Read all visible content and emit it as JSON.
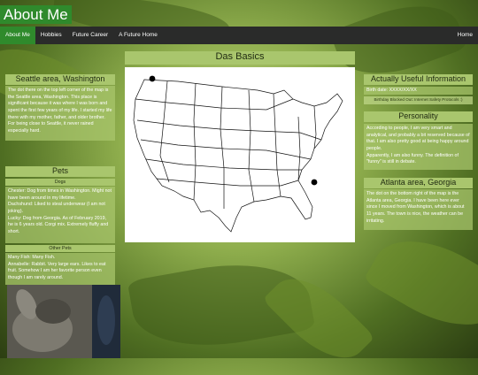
{
  "site": {
    "title": "About Me"
  },
  "nav": {
    "items": [
      "About Me",
      "Hobbies",
      "Future Career",
      "A Future Home"
    ],
    "home": "Home"
  },
  "center": {
    "title": "Das Basics"
  },
  "seattle": {
    "title": "Seattle area, Washington",
    "text": "The dot there on the top left corner of the map is the Seattle area, Washington. This place is significant because it was where I was born and spent the first few years of my life. I started my life there with my mother, father, and older brother. For being close to Seattle, it never rained especially hard."
  },
  "pets": {
    "title": "Pets",
    "dogs_title": "Dogs",
    "dogs_text": "Chester: Dog from times in Washington. Might not have been around in my lifetime.\nDachshund: Liked to steal underwear (I am not joking).\nLucky: Dog from Georgia. As of February 2019, he is 6 years old. Corgi mix. Extremely fluffy and short.",
    "other_title": "Other Pets",
    "other_text": "Many Fish: Many Fish.\nAnnabelle: Rabbit. Very large ears. Likes to eat fruit. Somehow I am her favorite person even though I am rarely around."
  },
  "useful": {
    "title": "Actually Useful Information",
    "birth": "Birth date: XXXX/XX/XX",
    "blocked": "Birthday Blocked Out: Internet Safety Protocols :)"
  },
  "personality": {
    "title": "Personality",
    "text": "According to people, I am very smart and analytical, and probably a bit reserved because of that. I am also pretty good at being happy around people.\nApparently, I am also funny. The definition of \"funny\" is still in debate."
  },
  "atlanta": {
    "title": "Atlanta area, Georgia",
    "text": "The dot on the bottom right of the map is the Atlanta area, Georgia. I have been here ever since I moved from Washington, which is about 11 years. The town is nice, the weather can be irritating."
  },
  "colors": {
    "nav_bg": "#2a2b2a",
    "accent_green": "#2f8a2c",
    "panel_header": "#a9c66d"
  },
  "icons": {
    "map": "usa-map-icon",
    "dot": "location-dot-icon",
    "photo": "rabbit-photo"
  }
}
